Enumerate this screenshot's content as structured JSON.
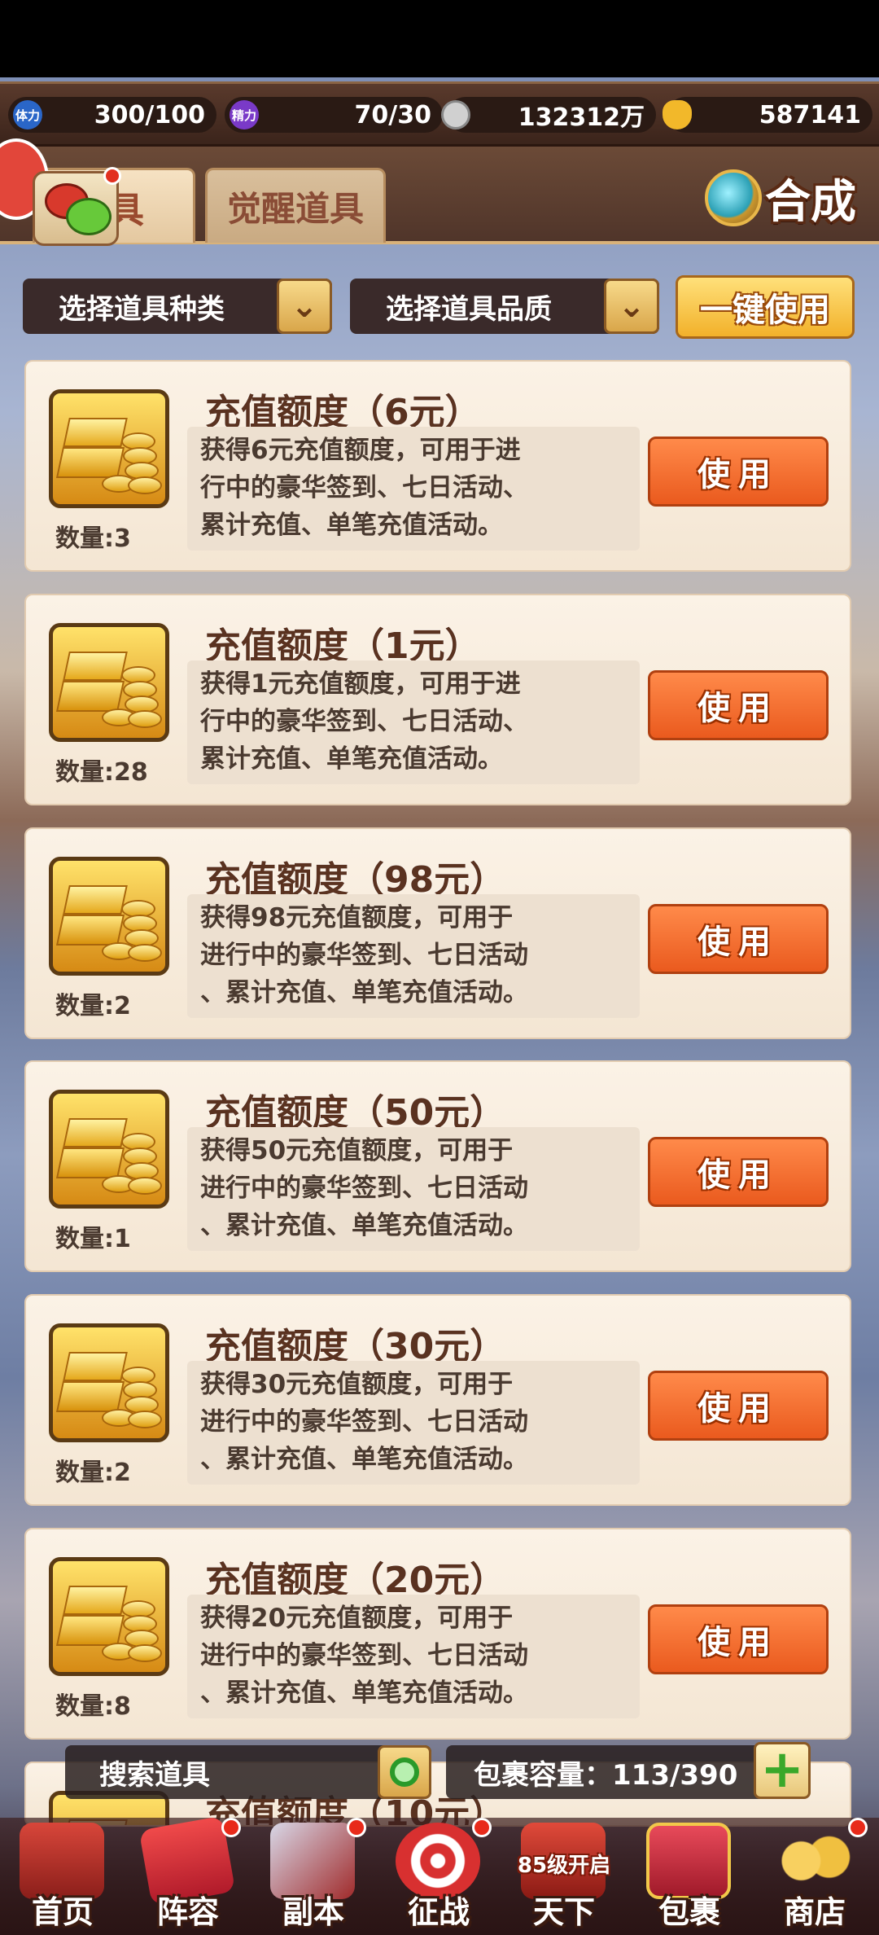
{
  "resources": {
    "stamina_label": "体力",
    "stamina": "300/100",
    "energy_label": "精力",
    "energy": "70/30",
    "copper": "132312万",
    "ingot": "587141"
  },
  "tabs": [
    {
      "label": "具"
    },
    {
      "label": "觉醒道具"
    }
  ],
  "synth_label": "合成",
  "filters": {
    "type": "选择道具种类",
    "quality": "选择道具品质",
    "one_key_use": "一键使用"
  },
  "items": [
    {
      "title": "充值额度（6元）",
      "desc_lines": [
        "获得6元充值额度，可用于进",
        "行中的豪华签到、七日活动、",
        "累计充值、单笔充值活动。"
      ],
      "qty": "数量:3",
      "use": "使用"
    },
    {
      "title": "充值额度（1元）",
      "desc_lines": [
        "获得1元充值额度，可用于进",
        "行中的豪华签到、七日活动、",
        "累计充值、单笔充值活动。"
      ],
      "qty": "数量:28",
      "use": "使用"
    },
    {
      "title": "充值额度（98元）",
      "desc_lines": [
        "获得98元充值额度，可用于",
        "进行中的豪华签到、七日活动",
        "、累计充值、单笔充值活动。"
      ],
      "qty": "数量:2",
      "use": "使用"
    },
    {
      "title": "充值额度（50元）",
      "desc_lines": [
        "获得50元充值额度，可用于",
        "进行中的豪华签到、七日活动",
        "、累计充值、单笔充值活动。"
      ],
      "qty": "数量:1",
      "use": "使用"
    },
    {
      "title": "充值额度（30元）",
      "desc_lines": [
        "获得30元充值额度，可用于",
        "进行中的豪华签到、七日活动",
        "、累计充值、单笔充值活动。"
      ],
      "qty": "数量:2",
      "use": "使用"
    },
    {
      "title": "充值额度（20元）",
      "desc_lines": [
        "获得20元充值额度，可用于",
        "进行中的豪华签到、七日活动",
        "、累计充值、单笔充值活动。"
      ],
      "qty": "数量:8",
      "use": "使用"
    },
    {
      "title": "充值额度（10元）",
      "desc_lines": [],
      "qty": "",
      "use": ""
    }
  ],
  "search": {
    "placeholder": "搜索道具"
  },
  "capacity": "包裹容量：113/390",
  "nav": [
    {
      "label": "首页"
    },
    {
      "label": "阵容"
    },
    {
      "label": "副本"
    },
    {
      "label": "征战"
    },
    {
      "label": "天下",
      "banner": "85级开启"
    },
    {
      "label": "包裹"
    },
    {
      "label": "商店"
    }
  ]
}
